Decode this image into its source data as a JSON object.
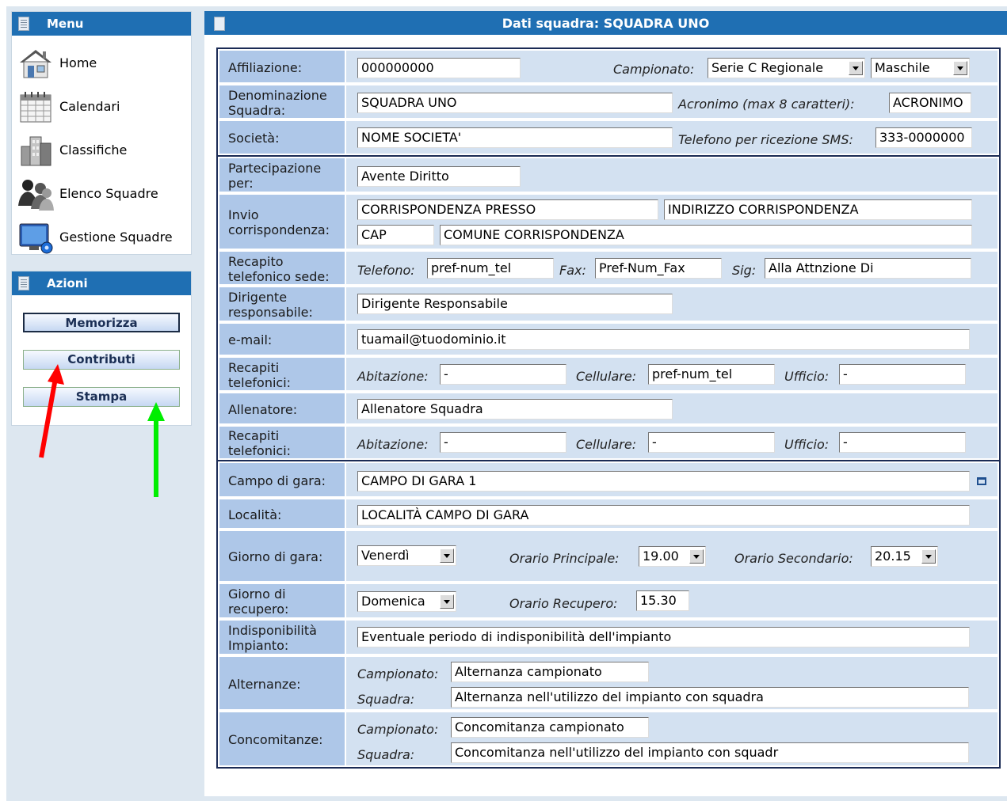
{
  "sidebar": {
    "menu_title": "Menu",
    "menu_items": [
      {
        "label": "Home",
        "icon": "home-icon"
      },
      {
        "label": "Calendari",
        "icon": "calendar-icon"
      },
      {
        "label": "Classifiche",
        "icon": "buildings-icon"
      },
      {
        "label": "Elenco Squadre",
        "icon": "people-icon"
      },
      {
        "label": "Gestione Squadre",
        "icon": "monitor-gear-icon"
      }
    ],
    "actions_title": "Azioni",
    "actions": [
      "Memorizza",
      "Contributi",
      "Stampa"
    ]
  },
  "main": {
    "title": "Dati squadra: SQUADRA UNO",
    "labels": {
      "affiliazione": "Affiliazione:",
      "denominazione": "Denominazione Squadra:",
      "societa": "Società:",
      "partecipazione": "Partecipazione per:",
      "invio": "Invio corrispondenza:",
      "recapito_sede": "Recapito telefonico sede:",
      "dirigente": "Dirigente responsabile:",
      "email": "e-mail:",
      "recapiti1": "Recapiti telefonici:",
      "allenatore": "Allenatore:",
      "recapiti2": "Recapiti telefonici:",
      "campo": "Campo di gara:",
      "localita": "Località:",
      "giorno_gara": "Giorno di gara:",
      "giorno_recupero": "Giorno di recupero:",
      "indisponibilita": "Indisponibilità Impianto:",
      "alternanze": "Alternanze:",
      "concomitanze": "Concomitanze:"
    },
    "inline_labels": {
      "campionato": "Campionato:",
      "acronimo": "Acronimo (max 8 caratteri):",
      "telefono_sms": "Telefono per ricezione SMS:",
      "telefono": "Telefono:",
      "fax": "Fax:",
      "sig": "Sig:",
      "abitazione": "Abitazione:",
      "cellulare": "Cellulare:",
      "ufficio": "Ufficio:",
      "orario_principale": "Orario Principale:",
      "orario_secondario": "Orario Secondario:",
      "orario_recupero": "Orario Recupero:",
      "squadra": "Squadra:"
    },
    "values": {
      "affiliazione": "000000000",
      "campionato": "Serie C Regionale",
      "genere": "Maschile",
      "denominazione": "SQUADRA UNO",
      "acronimo": "ACRONIMO",
      "societa": "NOME SOCIETA'",
      "telefono_sms": "333-0000000",
      "partecipazione": "Avente Diritto",
      "presso": "CORRISPONDENZA PRESSO",
      "indirizzo": "INDIRIZZO CORRISPONDENZA",
      "cap": "CAP",
      "comune": "COMUNE CORRISPONDENZA",
      "telefono_sede": "pref-num_tel",
      "fax": "Pref-Num_Fax",
      "sig": "Alla Attnzione Di",
      "dirigente": "Dirigente Responsabile",
      "email": "tuamail@tuodominio.it",
      "dir_abitazione": "-",
      "dir_cellulare": "pref-num_tel",
      "dir_ufficio": "-",
      "allenatore": "Allenatore Squadra",
      "all_abitazione": "-",
      "all_cellulare": "-",
      "all_ufficio": "-",
      "campo": "CAMPO DI GARA 1",
      "localita": "LOCALITÀ CAMPO DI GARA",
      "giorno_gara": "Venerdì",
      "orario_principale": "19.00",
      "orario_secondario": "20.15",
      "giorno_recupero": "Domenica",
      "orario_recupero": "15.30",
      "indisponibilita": "Eventuale periodo di indisponibilità dell'impianto",
      "alt_campionato": "Alternanza campionato",
      "alt_squadra": "Alternanza nell'utilizzo del impianto con squadra",
      "conc_campionato": "Concomitanza campionato",
      "conc_squadra": "Concomitanza nell'utilizzo del impianto con squadr"
    }
  },
  "colors": {
    "header_blue": "#1f6fb3",
    "label_blue": "#aec7e8",
    "value_blue": "#d3e1f1",
    "arrow_red": "#ff0000",
    "arrow_green": "#00ee00"
  }
}
